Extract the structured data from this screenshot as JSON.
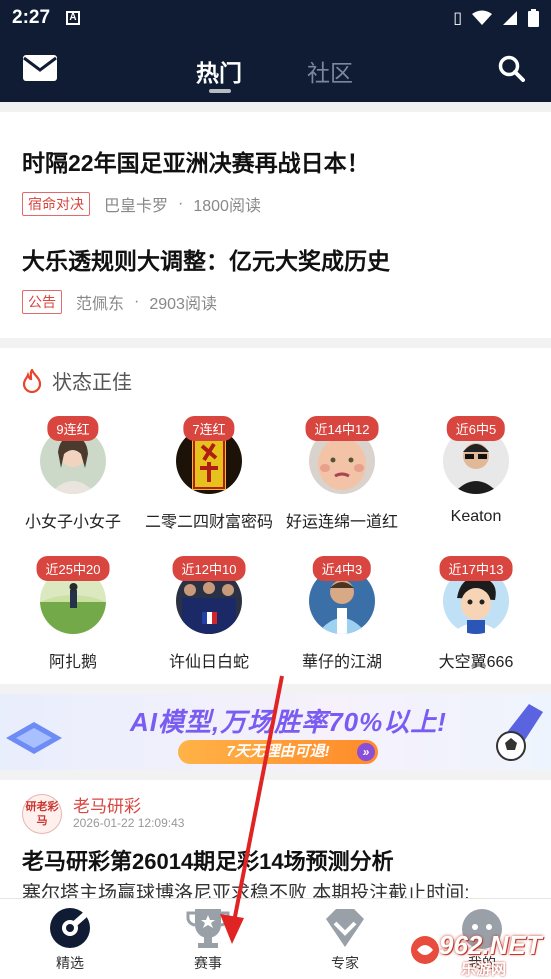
{
  "status_bar": {
    "time": "2:27",
    "notif_letter": "A"
  },
  "header": {
    "tabs": [
      "热门",
      "社区"
    ],
    "active_tab": "热门"
  },
  "headlines": [
    {
      "title": "时隔22年国足亚洲决赛再战日本！",
      "tag": "宿命对决",
      "author": "巴皇卡罗",
      "sep": "·",
      "reads": "1800阅读"
    },
    {
      "title": "大乐透规则大调整：亿元大奖成历史",
      "tag": "公告",
      "author": "范佩东",
      "sep": "·",
      "reads": "2903阅读"
    }
  ],
  "streak": {
    "title": "状态正佳",
    "users": [
      {
        "badge": "9连红",
        "name": "小女子小女子"
      },
      {
        "badge": "7连红",
        "name": "二零二四财富密码"
      },
      {
        "badge": "近14中12",
        "name": "好运连绵一道红"
      },
      {
        "badge": "近6中5",
        "name": "Keaton"
      },
      {
        "badge": "近25中20",
        "name": "阿扎鹅"
      },
      {
        "badge": "近12中10",
        "name": "许仙日白蛇"
      },
      {
        "badge": "近4中3",
        "name": "華仔的江湖"
      },
      {
        "badge": "近17中13",
        "name": "大空翼666"
      }
    ]
  },
  "banner": {
    "headline": "AI模型,万场胜率70%以上!",
    "cta": "7天无理由可退!"
  },
  "article": {
    "avatar_text": "研老彩马",
    "author": "老马研彩",
    "date": "2026-01-22 12:09:43",
    "title": "老马研彩第26014期足彩14场预测分析",
    "excerpt": "塞尔塔主场赢球博洛尼亚求稳不败 本期投注截止时间:"
  },
  "bottom_nav": [
    {
      "label": "精选",
      "icon": "compass-icon",
      "active": true
    },
    {
      "label": "赛事",
      "icon": "trophy-icon",
      "active": false
    },
    {
      "label": "专家",
      "icon": "diamond-icon",
      "active": false
    },
    {
      "label": "我的",
      "icon": "profile-icon",
      "active": false
    }
  ],
  "watermark": {
    "num": "962.NET",
    "sub": "乐游网"
  },
  "colors": {
    "header_bg": "#0f1c34",
    "accent_red": "#d9453f"
  }
}
